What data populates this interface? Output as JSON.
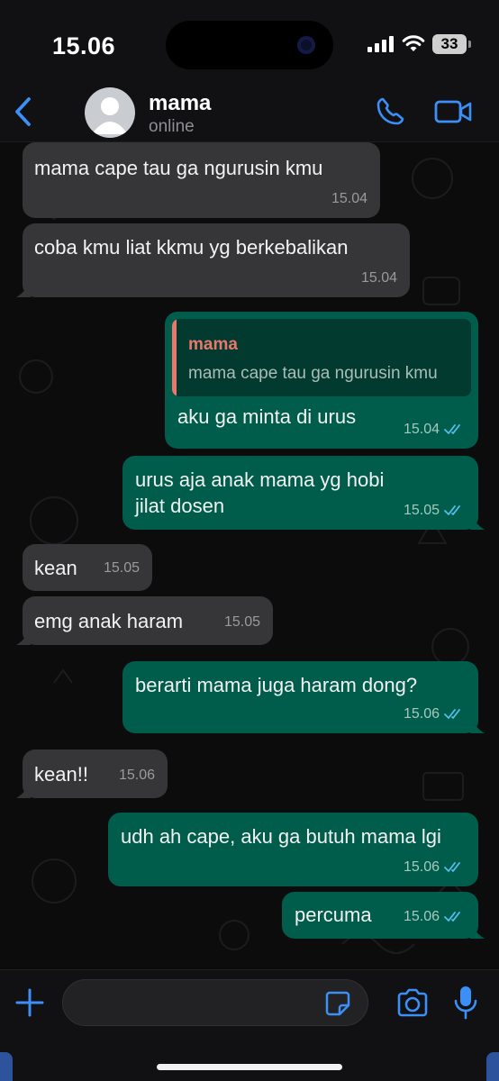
{
  "status_bar": {
    "time": "15.06",
    "battery": "33"
  },
  "header": {
    "name": "mama",
    "status": "online"
  },
  "messages": [
    {
      "dir": "in",
      "text": "mama cape tau ga ngurusin kmu",
      "time": "15.04"
    },
    {
      "dir": "in",
      "text": "coba kmu liat kkmu yg berkebalikan",
      "time": "15.04"
    },
    {
      "dir": "out",
      "text": "aku ga minta di urus",
      "time": "15.04",
      "reply_to": {
        "name": "mama",
        "text": "mama cape tau ga ngurusin kmu"
      }
    },
    {
      "dir": "out",
      "text": "urus aja anak mama yg hobi jilat dosen",
      "time": "15.05"
    },
    {
      "dir": "in",
      "text": "kean",
      "time": "15.05"
    },
    {
      "dir": "in",
      "text": "emg anak haram",
      "time": "15.05"
    },
    {
      "dir": "out",
      "text": "berarti mama juga haram dong?",
      "time": "15.06"
    },
    {
      "dir": "in",
      "text": "kean!!",
      "time": "15.06"
    },
    {
      "dir": "out",
      "text": "udh ah cape, aku ga butuh mama lgi",
      "time": "15.06"
    },
    {
      "dir": "out",
      "text": "percuma",
      "time": "15.06"
    }
  ],
  "input": {
    "value": "",
    "placeholder": ""
  },
  "colors": {
    "accent": "#3b8ff6",
    "incoming": "#363638",
    "outgoing": "#005c4b",
    "quote_name": "#e8776c",
    "read_ticks": "#53bdeb"
  },
  "icons": [
    "back-chevron-icon",
    "avatar-icon",
    "phone-icon",
    "video-icon",
    "plus-icon",
    "sticker-icon",
    "camera-icon",
    "mic-icon",
    "double-check-icon"
  ]
}
